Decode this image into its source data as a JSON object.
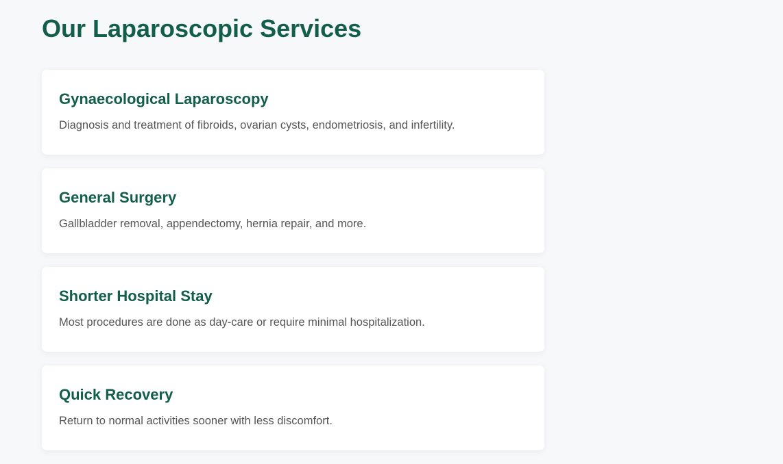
{
  "section": {
    "title": "Our Laparoscopic Services"
  },
  "services": [
    {
      "title": "Gynaecological Laparoscopy",
      "description": "Diagnosis and treatment of fibroids, ovarian cysts, endometriosis, and infertility."
    },
    {
      "title": "General Surgery",
      "description": "Gallbladder removal, appendectomy, hernia repair, and more."
    },
    {
      "title": "Shorter Hospital Stay",
      "description": "Most procedures are done as day-care or require minimal hospitalization."
    },
    {
      "title": "Quick Recovery",
      "description": "Return to normal activities sooner with less discomfort."
    }
  ],
  "colors": {
    "heading": "#135e4b",
    "body_text": "#555555",
    "card_background": "#ffffff",
    "page_background": "#f7f8fa"
  }
}
